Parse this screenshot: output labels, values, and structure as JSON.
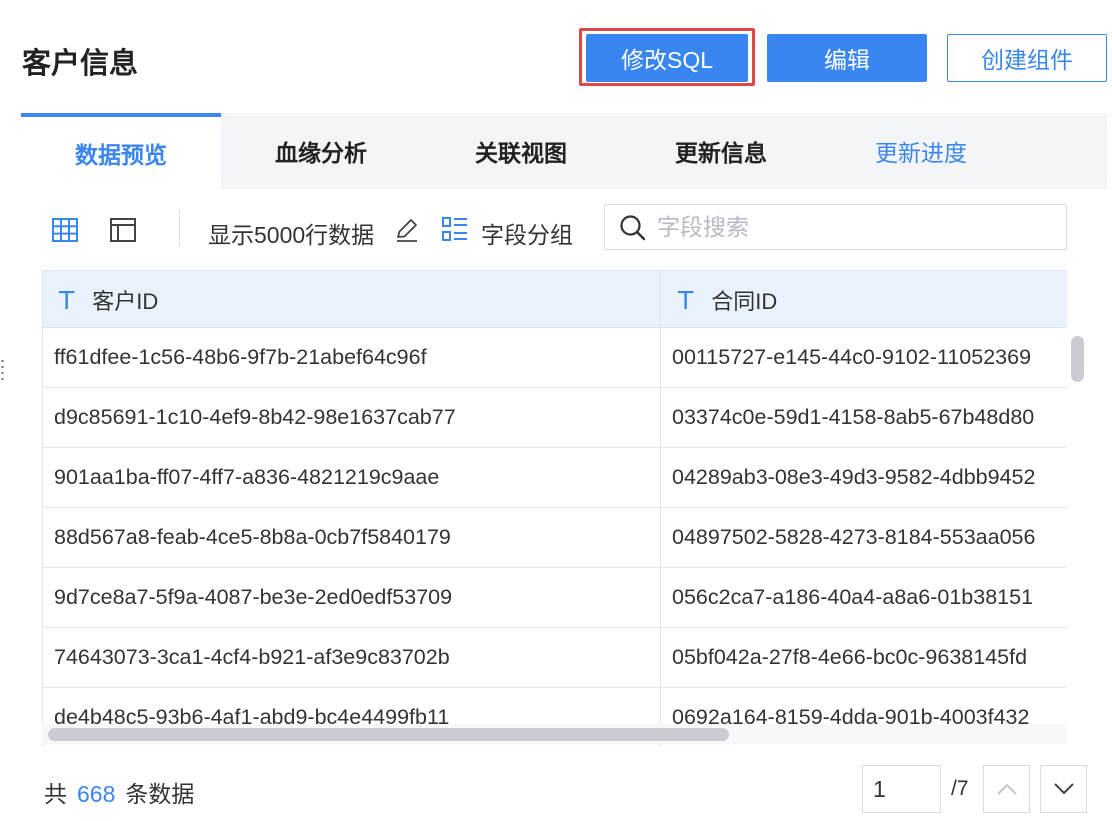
{
  "header": {
    "title": "客户信息",
    "modify_sql_label": "修改SQL",
    "edit_label": "编辑",
    "create_component_label": "创建组件"
  },
  "tabs": [
    {
      "label": "数据预览",
      "active": true
    },
    {
      "label": "血缘分析"
    },
    {
      "label": "关联视图"
    },
    {
      "label": "更新信息"
    },
    {
      "label": "更新进度"
    }
  ],
  "toolbar": {
    "show_rows_label": "显示5000行数据",
    "group_fields_label": "字段分组",
    "search_placeholder": "字段搜索",
    "icons": [
      "grid-view-icon",
      "layout-view-icon",
      "pencil-icon",
      "field-group-icon",
      "search-icon"
    ]
  },
  "table": {
    "columns": [
      {
        "label": "客户ID",
        "type_icon": "T"
      },
      {
        "label": "合同ID",
        "type_icon": "T"
      }
    ],
    "rows": [
      [
        "ff61dfee-1c56-48b6-9f7b-21abef64c96f",
        "00115727-e145-44c0-9102-11052369"
      ],
      [
        "d9c85691-1c10-4ef9-8b42-98e1637cab77",
        "03374c0e-59d1-4158-8ab5-67b48d80"
      ],
      [
        "901aa1ba-ff07-4ff7-a836-4821219c9aae",
        "04289ab3-08e3-49d3-9582-4dbb9452"
      ],
      [
        "88d567a8-feab-4ce5-8b8a-0cb7f5840179",
        "04897502-5828-4273-8184-553aa056"
      ],
      [
        "9d7ce8a7-5f9a-4087-be3e-2ed0edf53709",
        "056c2ca7-a186-40a4-a8a6-01b38151"
      ],
      [
        "74643073-3ca1-4cf4-b921-af3e9c83702b",
        "05bf042a-27f8-4e66-bc0c-9638145fd"
      ],
      [
        "de4b48c5-93b6-4af1-abd9-bc4e4499fb11",
        "0692a164-8159-4dda-901b-4003f432"
      ]
    ]
  },
  "footer": {
    "total_prefix": "共",
    "total_count": "668",
    "total_suffix": "条数据",
    "current_page": "1",
    "total_pages": "/7"
  },
  "colors": {
    "accent": "#3a86f0",
    "highlight_frame": "#e04848",
    "header_row_bg": "#e9f2fd",
    "tabbar_bg": "#f3f5f8"
  }
}
